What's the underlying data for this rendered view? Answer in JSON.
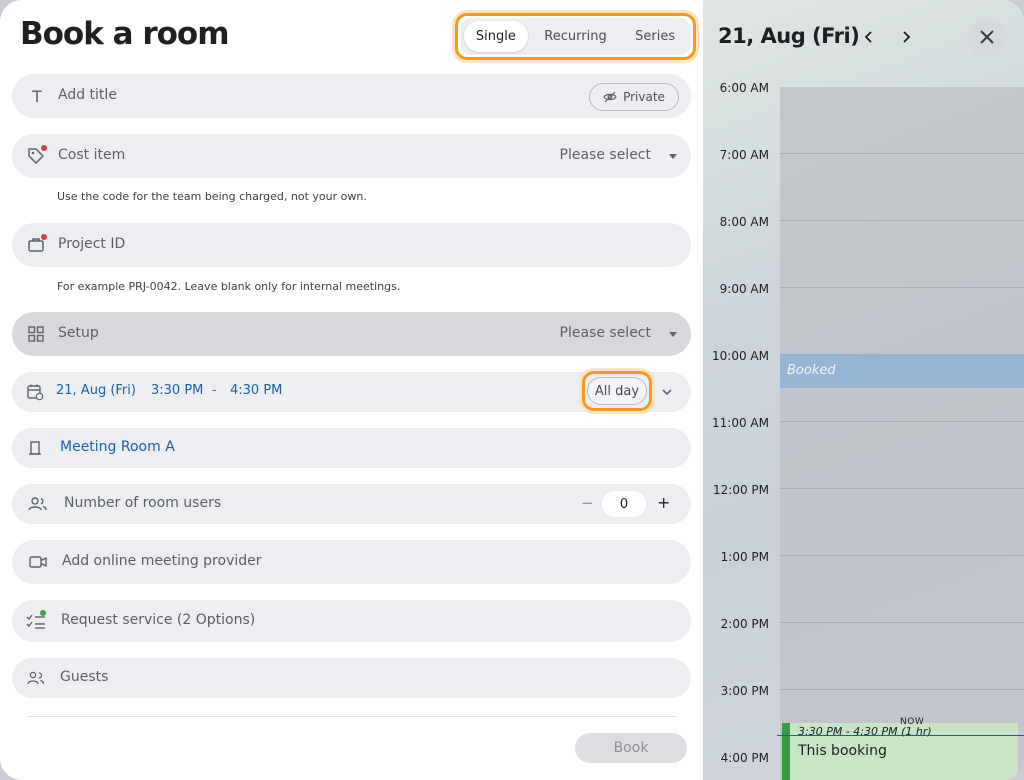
{
  "header": {
    "title": "Book a room"
  },
  "mode_tabs": [
    {
      "label": "Single",
      "active": true
    },
    {
      "label": "Recurring",
      "active": false
    },
    {
      "label": "Series",
      "active": false
    }
  ],
  "form": {
    "title_field": {
      "placeholder": "Add title",
      "private_label": "Private"
    },
    "cost_item": {
      "label": "Cost item",
      "value": "Please select",
      "hint": "Use the code for the team being charged, not your own."
    },
    "project_id": {
      "label": "Project ID",
      "hint": "For example PRJ-0042. Leave blank only for internal meetings."
    },
    "setup": {
      "label": "Setup",
      "value": "Please select"
    },
    "datetime": {
      "date": "21, Aug (Fri)",
      "start": "3:30 PM",
      "separator": "-",
      "end": "4:30 PM",
      "allday_label": "All day"
    },
    "room": {
      "label": "Meeting Room A"
    },
    "room_users": {
      "label": "Number of room users",
      "value": "0",
      "minus": "−",
      "plus": "+"
    },
    "online_meeting": {
      "label": "Add online meeting provider"
    },
    "request_service": {
      "label": "Request service (2 Options)"
    },
    "guests": {
      "label": "Guests"
    },
    "book_button": "Book"
  },
  "calendar": {
    "date": "21, Aug (Fri)",
    "prev_icon": "chevron-left-icon",
    "next_icon": "chevron-right-icon",
    "close_icon": "close-icon",
    "hours": [
      "6:00 AM",
      "7:00 AM",
      "8:00 AM",
      "9:00 AM",
      "10:00 AM",
      "11:00 AM",
      "12:00 PM",
      "1:00 PM",
      "2:00 PM",
      "3:00 PM",
      "4:00 PM"
    ],
    "booked_label": "Booked",
    "this_booking": {
      "time": "3:30 PM - 4:30 PM (1 hr)",
      "name": "This booking"
    },
    "now_label": "NOW"
  },
  "colors": {
    "accent_blue": "#1a5fa8",
    "highlight_orange": "#f39a1e",
    "booking_green": "#3a9b45",
    "required_red": "#e53935"
  }
}
